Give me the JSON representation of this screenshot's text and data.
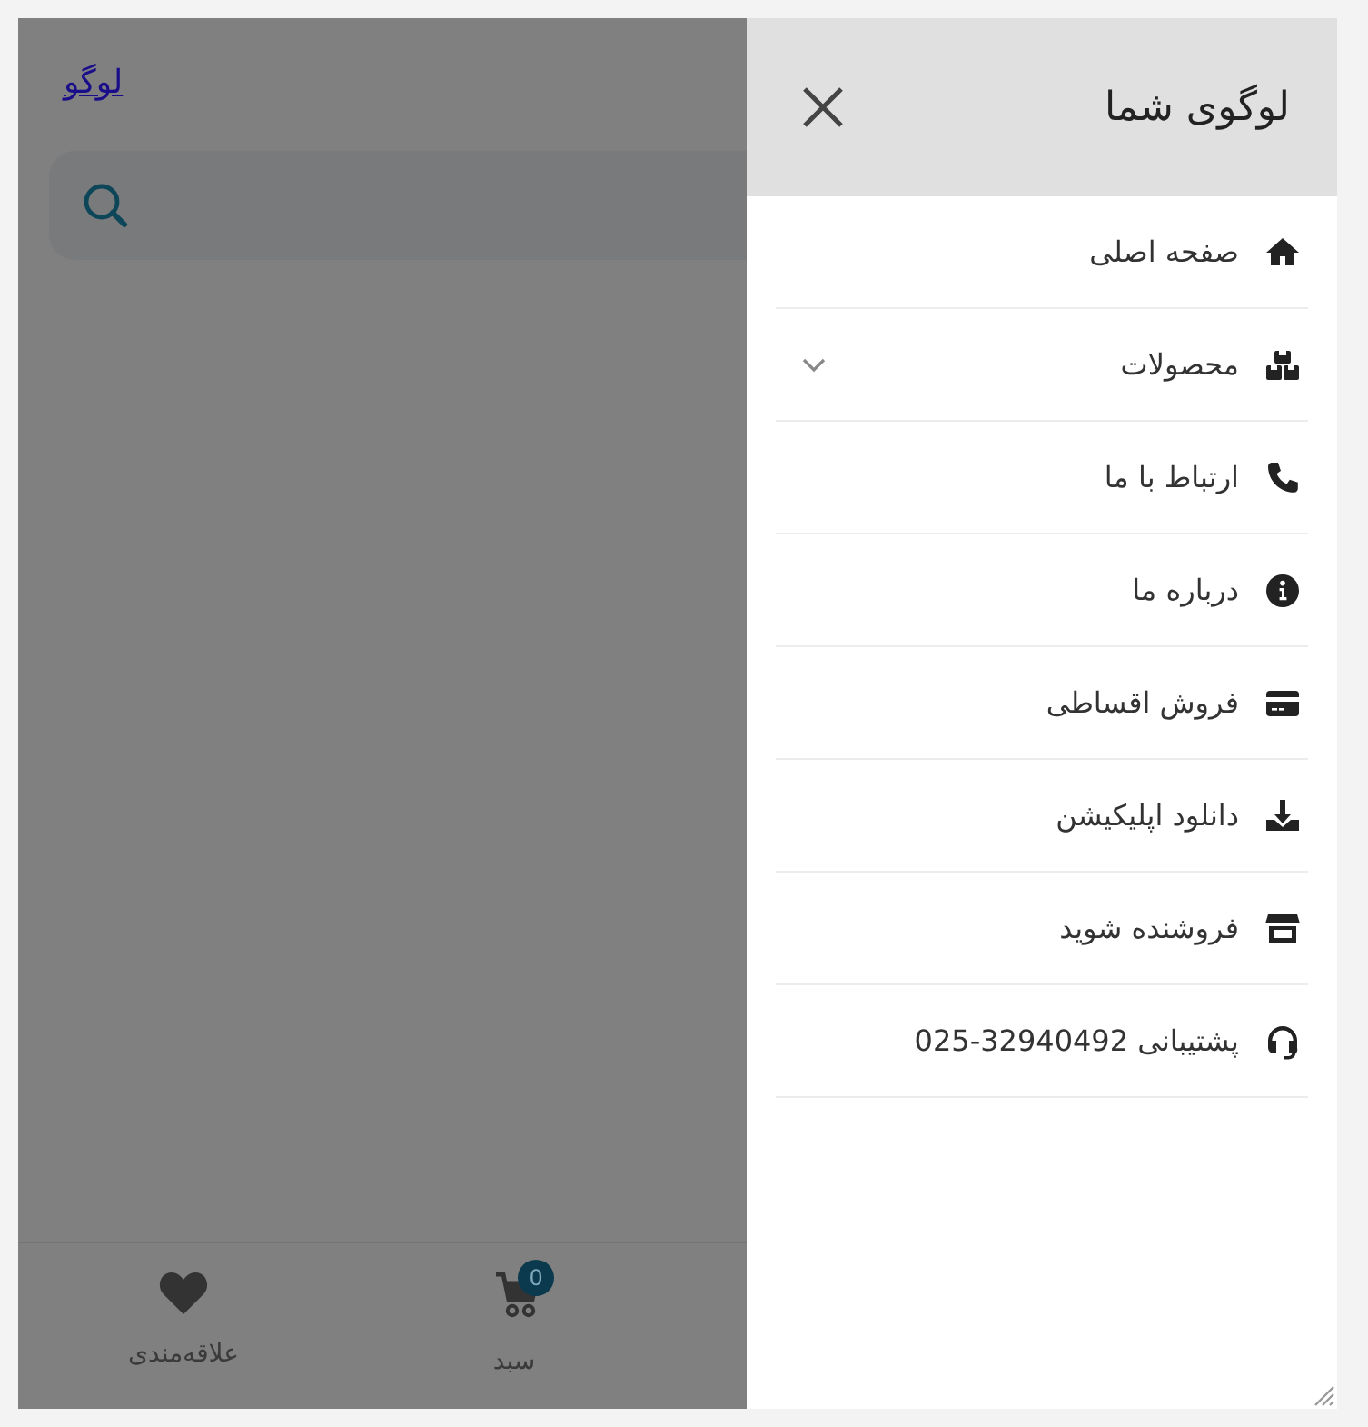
{
  "page": {
    "logo_link": "لوگو"
  },
  "bottom_nav": [
    {
      "kind": "cart",
      "label": "سبد",
      "badge": "0"
    },
    {
      "kind": "favorites",
      "label": "علاقه‌مندی"
    }
  ],
  "drawer": {
    "title": "لوگوی شما",
    "items": [
      {
        "kind": "home",
        "label": "صفحه اصلی",
        "has_submenu": false
      },
      {
        "kind": "products",
        "label": "محصولات",
        "has_submenu": true
      },
      {
        "kind": "phone",
        "label": "ارتباط با ما",
        "has_submenu": false
      },
      {
        "kind": "info",
        "label": "درباره ما",
        "has_submenu": false
      },
      {
        "kind": "card",
        "label": "فروش اقساطی",
        "has_submenu": false
      },
      {
        "kind": "download",
        "label": "دانلود اپلیکیشن",
        "has_submenu": false
      },
      {
        "kind": "store",
        "label": "فروشنده شوید",
        "has_submenu": false
      },
      {
        "kind": "support",
        "label": "پشتیبانی",
        "phone": "025-32940492",
        "has_submenu": false
      }
    ]
  }
}
